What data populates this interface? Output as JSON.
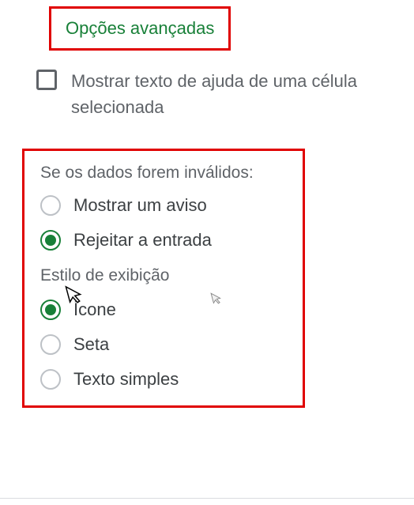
{
  "advancedOptions": {
    "label": "Opções avançadas"
  },
  "helpText": {
    "label": "Mostrar texto de ajuda de uma célula selecionada",
    "checked": false
  },
  "invalidData": {
    "title": "Se os dados forem inválidos:",
    "options": [
      {
        "label": "Mostrar um aviso",
        "selected": false
      },
      {
        "label": "Rejeitar a entrada",
        "selected": true
      }
    ]
  },
  "displayStyle": {
    "title": "Estilo de exibição",
    "options": [
      {
        "label": "Ícone",
        "selected": true
      },
      {
        "label": "Seta",
        "selected": false
      },
      {
        "label": "Texto simples",
        "selected": false
      }
    ]
  },
  "colors": {
    "accent": "#188038",
    "highlight": "#e00000"
  }
}
